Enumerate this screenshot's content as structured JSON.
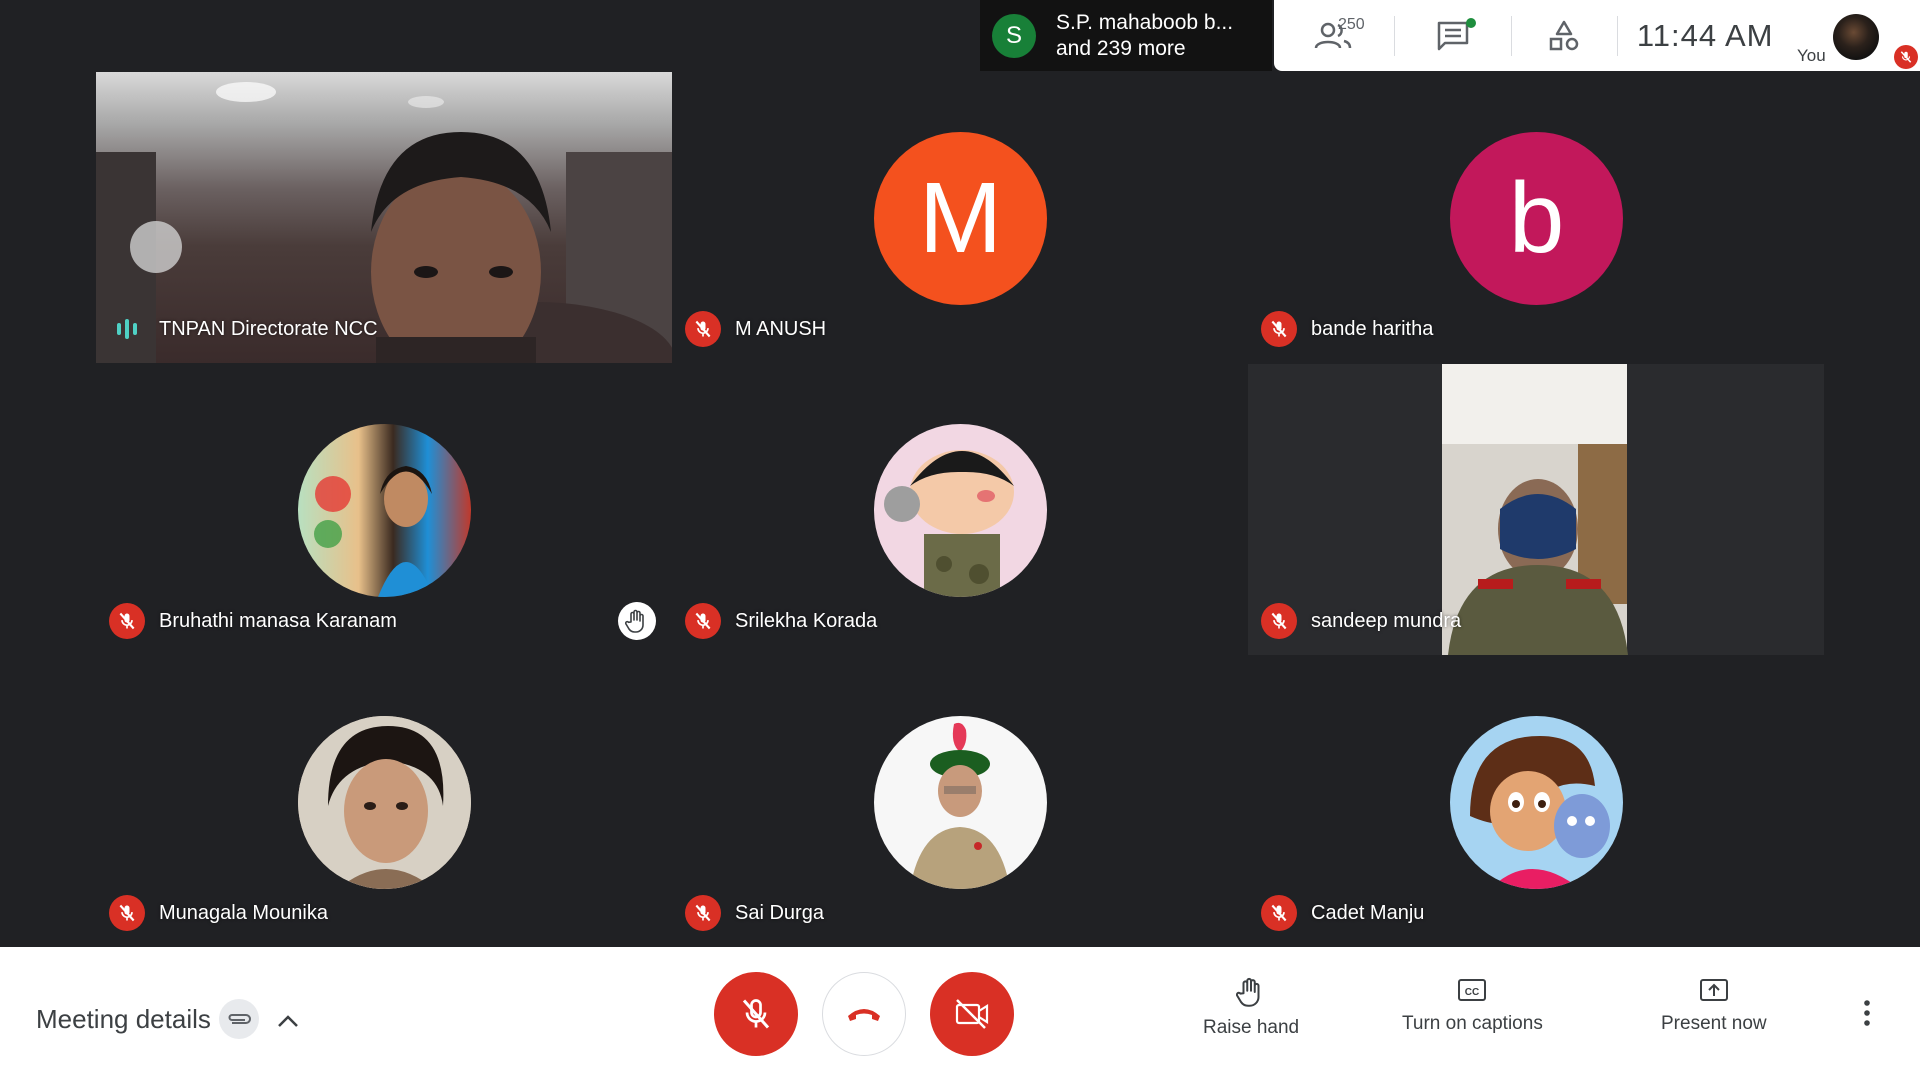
{
  "topbar": {
    "presenter_initial": "S",
    "presenter_line1": "S.P. mahaboob b...",
    "presenter_line2": "and 239 more",
    "participants_count": "250",
    "time": "11:44  AM",
    "you_label": "You"
  },
  "tiles": [
    {
      "name": "TNPAN Directorate NCC",
      "type": "video",
      "status": "speaking"
    },
    {
      "name": "M ANUSH",
      "type": "letter-avatar",
      "initial": "M",
      "color": "#f4511e",
      "status": "muted"
    },
    {
      "name": "bande haritha",
      "type": "letter-avatar",
      "initial": "b",
      "color": "#c2185b",
      "status": "muted"
    },
    {
      "name": "Bruhathi manasa Karanam",
      "type": "photo-avatar",
      "status": "muted",
      "hand_raised": true
    },
    {
      "name": "Srilekha Korada",
      "type": "photo-avatar",
      "status": "muted"
    },
    {
      "name": "sandeep mundra",
      "type": "video",
      "status": "muted"
    },
    {
      "name": "Munagala Mounika",
      "type": "photo-avatar",
      "status": "muted"
    },
    {
      "name": "Sai Durga",
      "type": "photo-avatar",
      "status": "muted"
    },
    {
      "name": "Cadet Manju",
      "type": "photo-avatar",
      "status": "muted"
    }
  ],
  "bottombar": {
    "meeting_details": "Meeting details",
    "raise_hand": "Raise hand",
    "captions": "Turn on captions",
    "present": "Present now"
  },
  "colors": {
    "muted_red": "#d93025",
    "speaking_teal": "#4fd1c5",
    "background": "#202124"
  }
}
